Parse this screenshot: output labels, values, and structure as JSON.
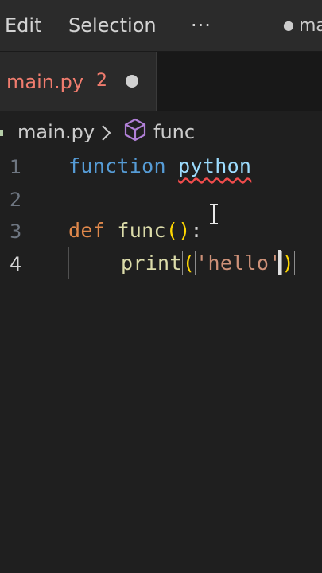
{
  "menubar": {
    "edit": "Edit",
    "selection": "Selection",
    "more": "···",
    "title": "ma"
  },
  "tab": {
    "name": "main.py",
    "problem_count": "2"
  },
  "breadcrumb": {
    "file": "main.py",
    "symbol": "func"
  },
  "editor": {
    "line_numbers": [
      "1",
      "2",
      "3",
      "4"
    ],
    "active_line": 4,
    "line1": {
      "keyword": "function",
      "word": "python"
    },
    "line3": {
      "keyword": "def",
      "name": "func",
      "open": "(",
      "close": ")",
      "colon": ":"
    },
    "line4": {
      "name": "print",
      "open": "(",
      "string": "'hello'",
      "close": ")"
    }
  },
  "colors": {
    "tab_modified": "#f07c6e",
    "keyword_def": "#e0884b",
    "keyword_blue": "#569cd6",
    "function": "#dcdcaa",
    "string": "#ce9178",
    "error_squiggle": "#f14c4c",
    "bracket": "#ffd700"
  }
}
